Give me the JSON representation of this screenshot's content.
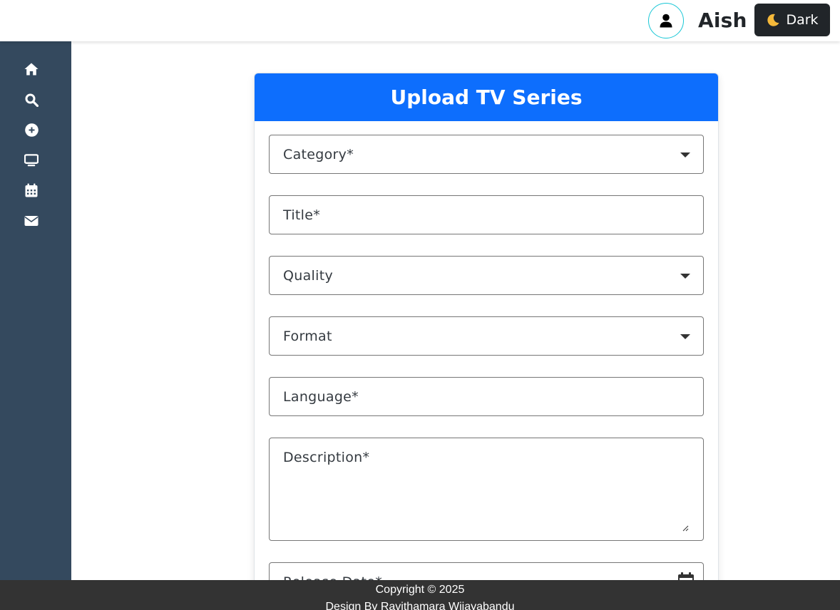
{
  "header": {
    "username": "Aish",
    "theme_button": {
      "icon": "moon-icon",
      "label": "Dark"
    },
    "avatar_icon": "user-icon"
  },
  "sidebar": {
    "items": [
      {
        "icon": "home-icon"
      },
      {
        "icon": "search-icon"
      },
      {
        "icon": "plus-circle-icon"
      },
      {
        "icon": "tv-icon"
      },
      {
        "icon": "calendar-icon"
      },
      {
        "icon": "envelope-icon"
      }
    ]
  },
  "form": {
    "title": "Upload TV Series",
    "fields": {
      "category": "Category*",
      "title": "Title*",
      "quality": "Quality",
      "format": "Format",
      "language": "Language*",
      "description": "Description*",
      "release_date": "Release Date*"
    }
  },
  "footer": {
    "copyright": "Copyright © 2025",
    "design_by": "Design By Ravithamara Wijayabandu"
  },
  "colors": {
    "header_bar": "#0d6efd",
    "sidebar": "#34495e",
    "footer": "#333333",
    "dark_button": "#212529",
    "avatar_border": "#19c7d6"
  }
}
